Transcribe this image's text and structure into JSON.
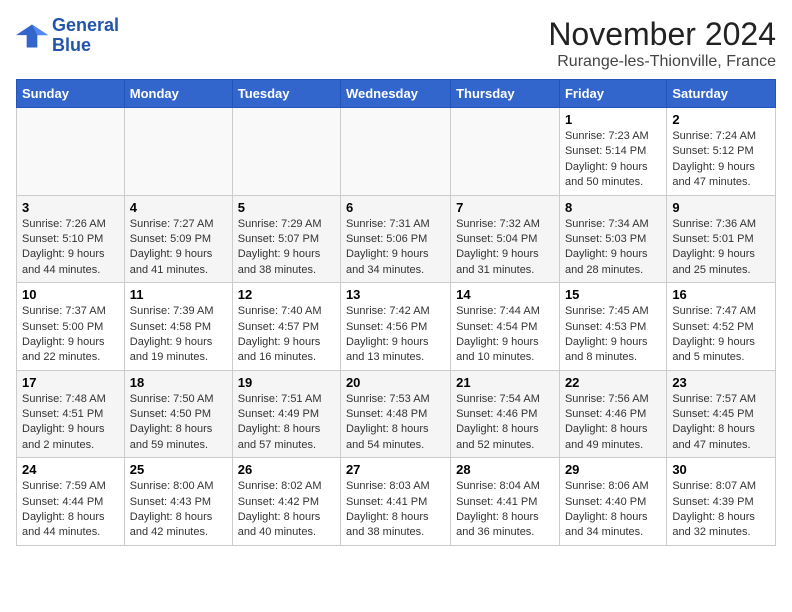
{
  "logo": {
    "line1": "General",
    "line2": "Blue"
  },
  "title": "November 2024",
  "subtitle": "Rurange-les-Thionville, France",
  "days_of_week": [
    "Sunday",
    "Monday",
    "Tuesday",
    "Wednesday",
    "Thursday",
    "Friday",
    "Saturday"
  ],
  "weeks": [
    [
      {
        "day": "",
        "info": ""
      },
      {
        "day": "",
        "info": ""
      },
      {
        "day": "",
        "info": ""
      },
      {
        "day": "",
        "info": ""
      },
      {
        "day": "",
        "info": ""
      },
      {
        "day": "1",
        "info": "Sunrise: 7:23 AM\nSunset: 5:14 PM\nDaylight: 9 hours and 50 minutes."
      },
      {
        "day": "2",
        "info": "Sunrise: 7:24 AM\nSunset: 5:12 PM\nDaylight: 9 hours and 47 minutes."
      }
    ],
    [
      {
        "day": "3",
        "info": "Sunrise: 7:26 AM\nSunset: 5:10 PM\nDaylight: 9 hours and 44 minutes."
      },
      {
        "day": "4",
        "info": "Sunrise: 7:27 AM\nSunset: 5:09 PM\nDaylight: 9 hours and 41 minutes."
      },
      {
        "day": "5",
        "info": "Sunrise: 7:29 AM\nSunset: 5:07 PM\nDaylight: 9 hours and 38 minutes."
      },
      {
        "day": "6",
        "info": "Sunrise: 7:31 AM\nSunset: 5:06 PM\nDaylight: 9 hours and 34 minutes."
      },
      {
        "day": "7",
        "info": "Sunrise: 7:32 AM\nSunset: 5:04 PM\nDaylight: 9 hours and 31 minutes."
      },
      {
        "day": "8",
        "info": "Sunrise: 7:34 AM\nSunset: 5:03 PM\nDaylight: 9 hours and 28 minutes."
      },
      {
        "day": "9",
        "info": "Sunrise: 7:36 AM\nSunset: 5:01 PM\nDaylight: 9 hours and 25 minutes."
      }
    ],
    [
      {
        "day": "10",
        "info": "Sunrise: 7:37 AM\nSunset: 5:00 PM\nDaylight: 9 hours and 22 minutes."
      },
      {
        "day": "11",
        "info": "Sunrise: 7:39 AM\nSunset: 4:58 PM\nDaylight: 9 hours and 19 minutes."
      },
      {
        "day": "12",
        "info": "Sunrise: 7:40 AM\nSunset: 4:57 PM\nDaylight: 9 hours and 16 minutes."
      },
      {
        "day": "13",
        "info": "Sunrise: 7:42 AM\nSunset: 4:56 PM\nDaylight: 9 hours and 13 minutes."
      },
      {
        "day": "14",
        "info": "Sunrise: 7:44 AM\nSunset: 4:54 PM\nDaylight: 9 hours and 10 minutes."
      },
      {
        "day": "15",
        "info": "Sunrise: 7:45 AM\nSunset: 4:53 PM\nDaylight: 9 hours and 8 minutes."
      },
      {
        "day": "16",
        "info": "Sunrise: 7:47 AM\nSunset: 4:52 PM\nDaylight: 9 hours and 5 minutes."
      }
    ],
    [
      {
        "day": "17",
        "info": "Sunrise: 7:48 AM\nSunset: 4:51 PM\nDaylight: 9 hours and 2 minutes."
      },
      {
        "day": "18",
        "info": "Sunrise: 7:50 AM\nSunset: 4:50 PM\nDaylight: 8 hours and 59 minutes."
      },
      {
        "day": "19",
        "info": "Sunrise: 7:51 AM\nSunset: 4:49 PM\nDaylight: 8 hours and 57 minutes."
      },
      {
        "day": "20",
        "info": "Sunrise: 7:53 AM\nSunset: 4:48 PM\nDaylight: 8 hours and 54 minutes."
      },
      {
        "day": "21",
        "info": "Sunrise: 7:54 AM\nSunset: 4:46 PM\nDaylight: 8 hours and 52 minutes."
      },
      {
        "day": "22",
        "info": "Sunrise: 7:56 AM\nSunset: 4:46 PM\nDaylight: 8 hours and 49 minutes."
      },
      {
        "day": "23",
        "info": "Sunrise: 7:57 AM\nSunset: 4:45 PM\nDaylight: 8 hours and 47 minutes."
      }
    ],
    [
      {
        "day": "24",
        "info": "Sunrise: 7:59 AM\nSunset: 4:44 PM\nDaylight: 8 hours and 44 minutes."
      },
      {
        "day": "25",
        "info": "Sunrise: 8:00 AM\nSunset: 4:43 PM\nDaylight: 8 hours and 42 minutes."
      },
      {
        "day": "26",
        "info": "Sunrise: 8:02 AM\nSunset: 4:42 PM\nDaylight: 8 hours and 40 minutes."
      },
      {
        "day": "27",
        "info": "Sunrise: 8:03 AM\nSunset: 4:41 PM\nDaylight: 8 hours and 38 minutes."
      },
      {
        "day": "28",
        "info": "Sunrise: 8:04 AM\nSunset: 4:41 PM\nDaylight: 8 hours and 36 minutes."
      },
      {
        "day": "29",
        "info": "Sunrise: 8:06 AM\nSunset: 4:40 PM\nDaylight: 8 hours and 34 minutes."
      },
      {
        "day": "30",
        "info": "Sunrise: 8:07 AM\nSunset: 4:39 PM\nDaylight: 8 hours and 32 minutes."
      }
    ]
  ]
}
